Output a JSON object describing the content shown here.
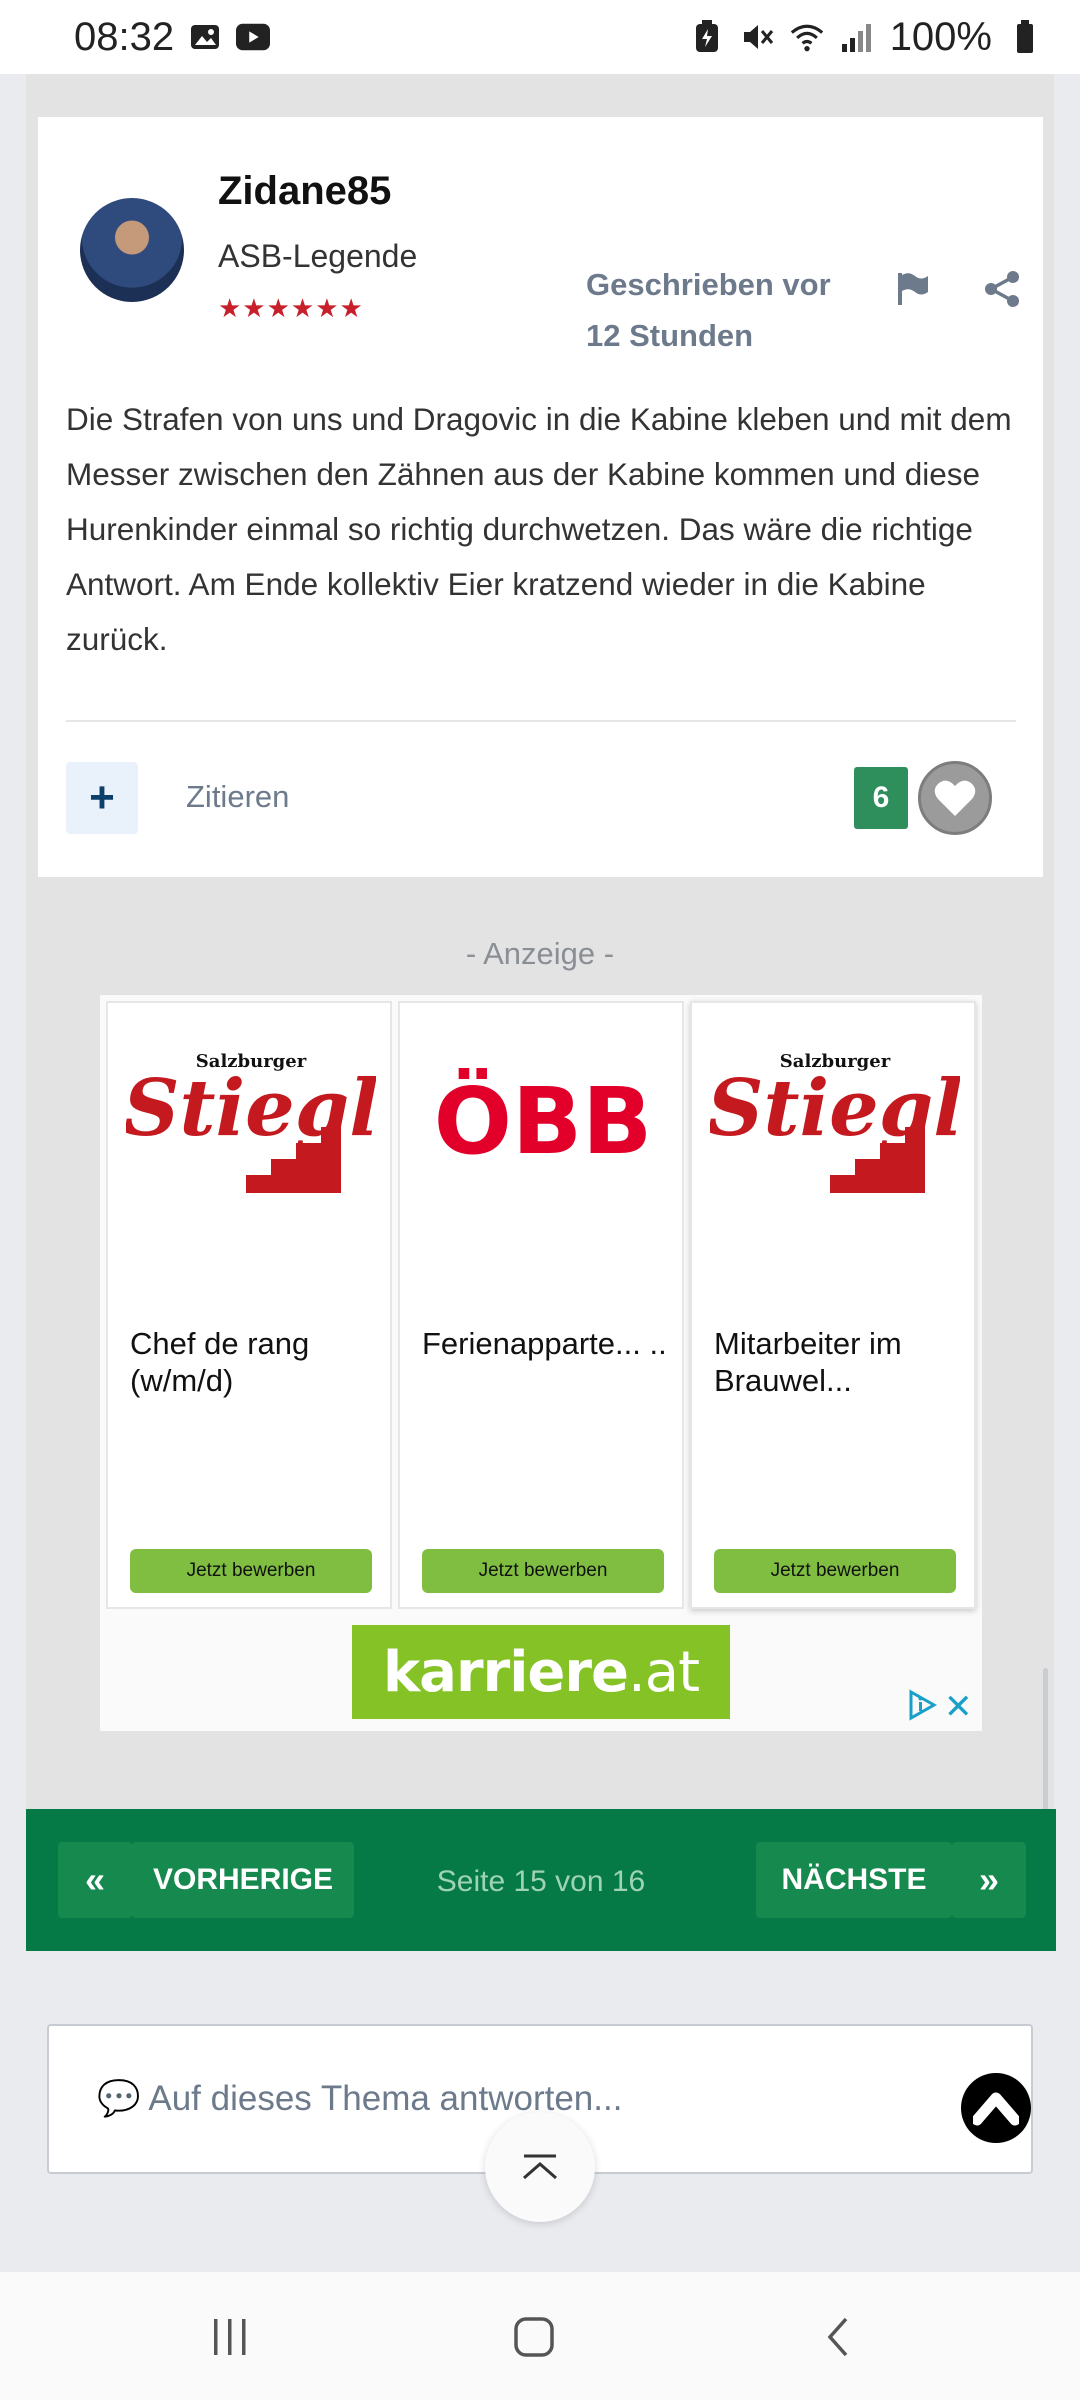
{
  "status_bar": {
    "time": "08:32",
    "battery": "100%"
  },
  "post": {
    "author": "Zidane85",
    "rank": "ASB-Legende",
    "stars": "★★★★★★",
    "posted": "Geschrieben vor 12 Stunden",
    "text": "Die Strafen von uns und Dragovic  in die Kabine kleben und mit dem Messer zwischen den Zähnen aus der Kabine kommen und diese Hurenkinder einmal so richtig durchwetzen. Das wäre die richtige Antwort. Am Ende kollektiv Eier kratzend wieder in die Kabine zurück.",
    "plus_label": "+",
    "quote_label": "Zitieren",
    "reaction_count": "6"
  },
  "ad": {
    "label": "- Anzeige -",
    "cards": [
      {
        "logo_top": "Salzburger",
        "logo": "Stiegl",
        "title": "Chef de rang (w/m/d)",
        "button": "Jetzt bewerben"
      },
      {
        "logo": "ÖBB",
        "title": "Ferienapparte... ..",
        "button": "Jetzt bewerben"
      },
      {
        "logo_top": "Salzburger",
        "logo": "Stiegl",
        "title": "Mitarbeiter im Brauwel...",
        "button": "Jetzt bewerben"
      }
    ],
    "brand": "karriere",
    "brand_tld": ".at"
  },
  "pagination": {
    "prev_arrow": "«",
    "prev_label": "VORHERIGE",
    "info": "Seite 15 von 16",
    "next_label": "NÄCHSTE",
    "next_arrow": "»"
  },
  "reply": {
    "placeholder": "💬 Auf dieses Thema antworten..."
  },
  "colors": {
    "accent_green": "#067a46",
    "reaction_green": "#2e8e5c",
    "ad_green": "#84c225",
    "stars_red": "#c8202a"
  }
}
